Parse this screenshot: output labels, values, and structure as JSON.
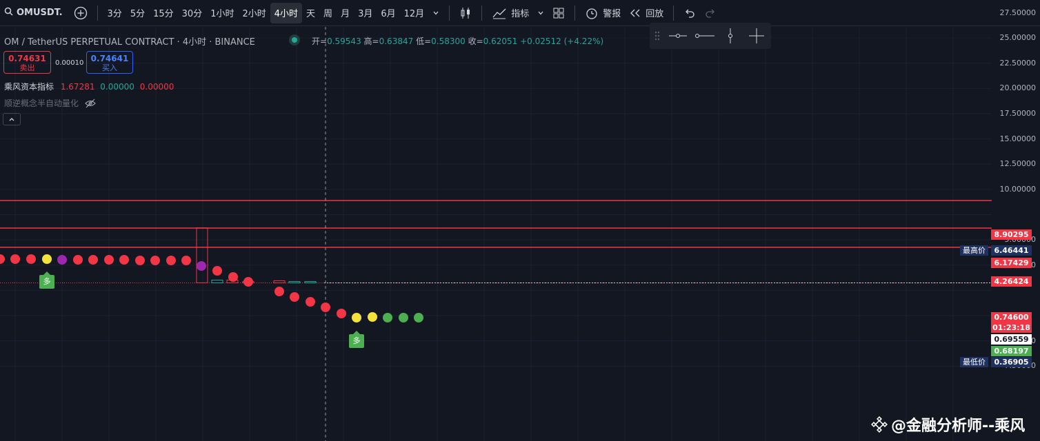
{
  "toolbar": {
    "symbol": "OMUSDT.",
    "intervals": [
      "3分",
      "5分",
      "15分",
      "30分",
      "1小时",
      "2小时",
      "4小时",
      "天",
      "周",
      "月",
      "3月",
      "6月",
      "12月"
    ],
    "selected_interval": "4小时",
    "indicators_label": "指标",
    "alert_label": "警报",
    "replay_label": "回放"
  },
  "legend": {
    "title": "OM / TetherUS PERPETUAL CONTRACT · 4小时 · BINANCE",
    "open_label": "开",
    "open": "0.59543",
    "high_label": "高",
    "high": "0.63847",
    "low_label": "低",
    "low": "0.58300",
    "close_label": "收",
    "close": "0.62051",
    "change": "+0.02512 (+4.22%)"
  },
  "trade": {
    "sell_price": "0.74631",
    "sell_label": "卖出",
    "spread": "0.00010",
    "buy_price": "0.74641",
    "buy_label": "买入"
  },
  "indicator1": {
    "name": "乘风资本指标",
    "v1": "1.67281",
    "v2": "0.00000",
    "v3": "0.00000"
  },
  "indicator2": {
    "name": "顺逆概念半自动量化"
  },
  "price_axis": {
    "ticks": [
      "27.50000",
      "25.00000",
      "22.50000",
      "20.00000",
      "17.50000",
      "15.00000",
      "12.50000",
      "10.00000",
      "5.00000",
      "2.50000",
      "-5.00000",
      "-7.50000"
    ],
    "labels": [
      {
        "value": "8.90295",
        "color": "#f23645"
      },
      {
        "value": "6.46441",
        "color": "#1e3160",
        "caption": "最高价"
      },
      {
        "value": "6.17429",
        "color": "#f23645"
      },
      {
        "value": "4.26424",
        "color": "#f23645"
      },
      {
        "value": "0.74600",
        "color": "#f23645"
      },
      {
        "value": "01:23:18",
        "color": "#f23645"
      },
      {
        "value": "0.69559",
        "color": "#ffffff"
      },
      {
        "value": "0.68197",
        "color": "#4caf50"
      },
      {
        "value": "0.36905",
        "color": "#1e3160",
        "caption": "最低价"
      }
    ]
  },
  "signals": [
    {
      "text": "多"
    },
    {
      "text": "多"
    }
  ],
  "watermark": "@金融分析师--乘风"
}
